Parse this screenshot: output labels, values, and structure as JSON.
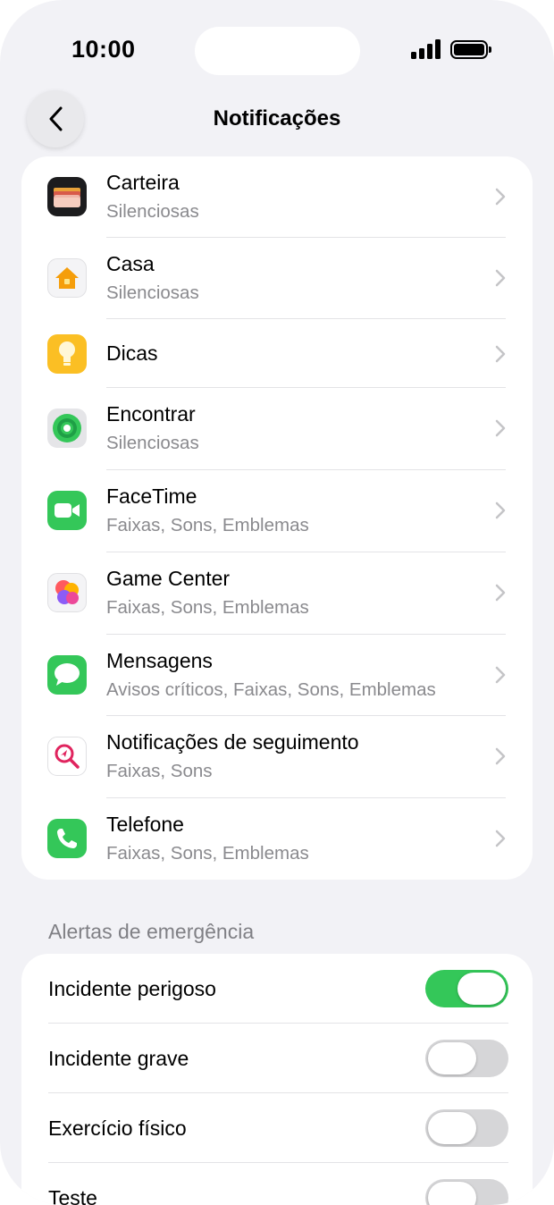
{
  "status_bar": {
    "time": "10:00"
  },
  "nav": {
    "title": "Notificações"
  },
  "apps": [
    {
      "name": "Carteira",
      "subtitle": "Silenciosas",
      "icon": "wallet-icon"
    },
    {
      "name": "Casa",
      "subtitle": "Silenciosas",
      "icon": "home-icon"
    },
    {
      "name": "Dicas",
      "subtitle": "",
      "icon": "tips-icon"
    },
    {
      "name": "Encontrar",
      "subtitle": "Silenciosas",
      "icon": "find-my-icon"
    },
    {
      "name": "FaceTime",
      "subtitle": "Faixas, Sons, Emblemas",
      "icon": "facetime-icon"
    },
    {
      "name": "Game Center",
      "subtitle": "Faixas, Sons, Emblemas",
      "icon": "game-center-icon"
    },
    {
      "name": "Mensagens",
      "subtitle": "Avisos críticos, Faixas, Sons, Emblemas",
      "icon": "messages-icon"
    },
    {
      "name": "Notificações de seguimento",
      "subtitle": "Faixas, Sons",
      "icon": "tracking-notifications-icon"
    },
    {
      "name": "Telefone",
      "subtitle": "Faixas, Sons, Emblemas",
      "icon": "phone-icon"
    }
  ],
  "emergency": {
    "header": "Alertas de emergência",
    "items": [
      {
        "label": "Incidente perigoso",
        "on": true
      },
      {
        "label": "Incidente grave",
        "on": false
      },
      {
        "label": "Exercício físico",
        "on": false
      },
      {
        "label": "Teste",
        "on": false
      }
    ]
  },
  "colors": {
    "toggle_on": "#34c759",
    "toggle_off": "#d6d6d8",
    "background": "#f2f2f6"
  }
}
